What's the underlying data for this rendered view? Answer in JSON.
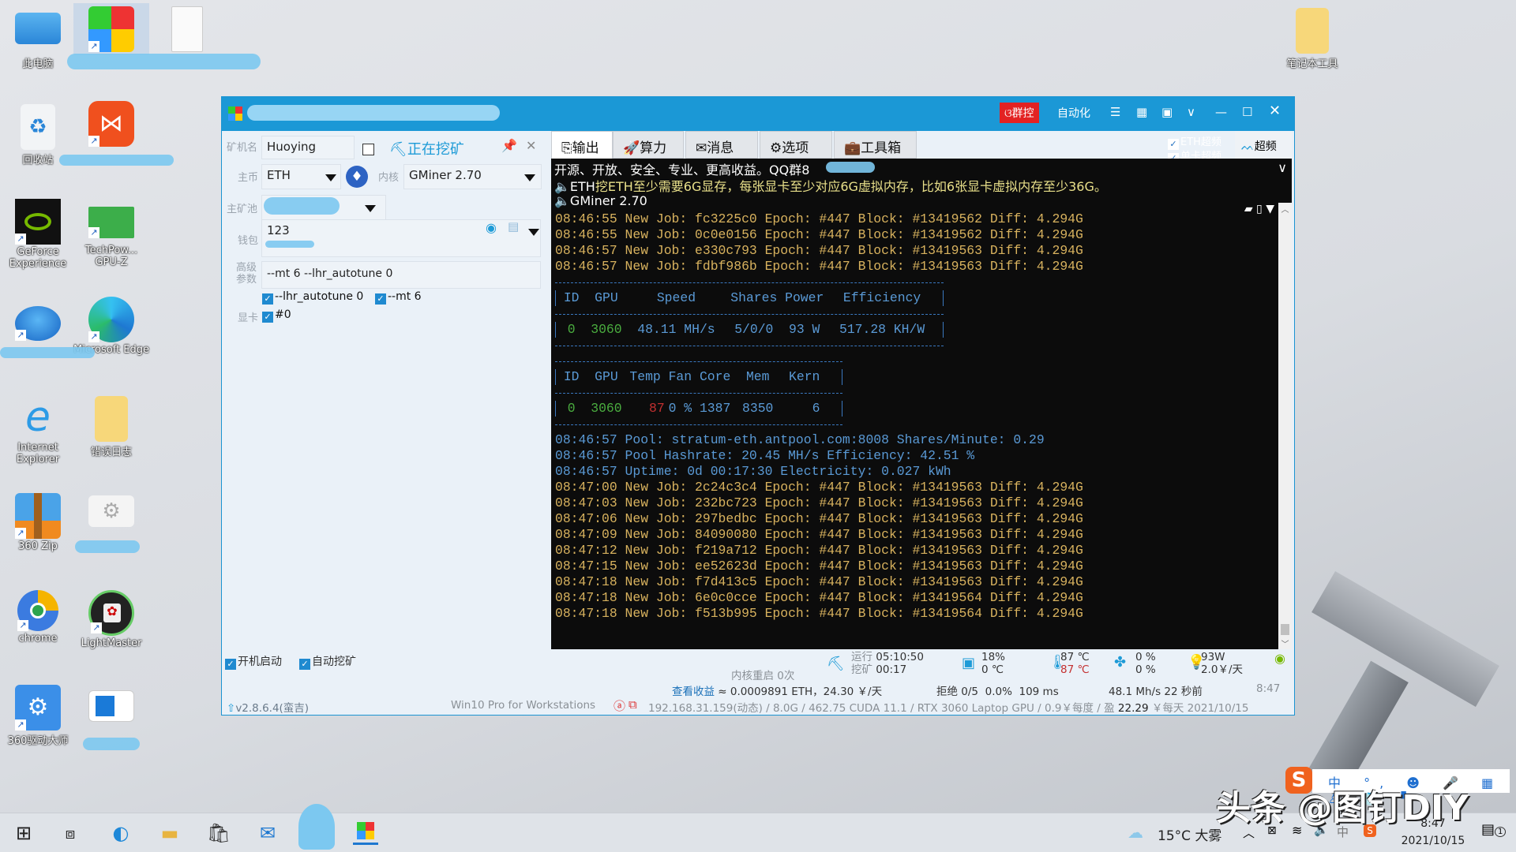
{
  "desktop": {
    "icons": [
      {
        "label": "此电脑"
      },
      {
        "label": "回收站"
      },
      {
        "label": "GeForce Experience"
      },
      {
        "label": "Internet Explorer"
      },
      {
        "label": "360 Zip"
      },
      {
        "label": "chrome"
      },
      {
        "label": "360驱动大师"
      },
      {
        "label": "TechPow... GPU-Z"
      },
      {
        "label": "Microsoft Edge"
      },
      {
        "label": "错误日志"
      },
      {
        "label": "LightMaster"
      },
      {
        "label": "笔记本工具"
      }
    ]
  },
  "window": {
    "title_buttons": {
      "group": "群控",
      "auto": "自动化"
    },
    "left": {
      "miner_name_label": "矿机名",
      "miner_name": "Huoying",
      "status": "正在挖矿",
      "coin_label": "主币",
      "coin": "ETH",
      "kernel_label": "内核",
      "kernel": "GMiner 2.70",
      "pool_label": "主矿池",
      "wallet_label": "钱包",
      "wallet": "123",
      "params_label_1": "高级",
      "params_label_2": "参数",
      "params": "--mt 6 --lhr_autotune 0",
      "opt1": "--lhr_autotune 0",
      "opt2": "--mt 6",
      "gpu_label": "显卡",
      "gpu": "#0",
      "autostart": "开机启动",
      "automine": "自动挖矿"
    },
    "tabs": [
      "输出",
      "算力",
      "消息",
      "选项",
      "工具箱"
    ],
    "oc": {
      "eth_oc": "ETH超频",
      "card_oc": "单卡超频",
      "oc_button": "超频"
    },
    "announcements": [
      "开源、开放、安全、专业、更高收益。QQ群8",
      "挖ETH至少需要6G显存，每张显卡至少对应6G虚拟内存，比如6张显卡虚拟内存至少36G。",
      "GMiner 2.70"
    ],
    "ann_prefix": "ETH",
    "log_top": [
      "08:46:55 New Job: fc3225c0 Epoch: #447 Block: #13419562 Diff: 4.294G",
      "08:46:55 New Job: 0c0e0156 Epoch: #447 Block: #13419562 Diff: 4.294G",
      "08:46:57 New Job: e330c793 Epoch: #447 Block: #13419563 Diff: 4.294G",
      "08:46:57 New Job: fdbf986b Epoch: #447 Block: #13419563 Diff: 4.294G"
    ],
    "table1": {
      "headers": [
        "ID",
        "GPU",
        "Speed",
        "Shares",
        "Power",
        "Efficiency"
      ],
      "row": [
        "0",
        "3060",
        "48.11 MH/s",
        "5/0/0",
        "93 W",
        "517.28 KH/W"
      ]
    },
    "table2": {
      "headers": [
        "ID",
        "GPU",
        "Temp",
        "Fan",
        "Core",
        "Mem",
        "Kern"
      ],
      "row": [
        "0",
        "3060",
        "87",
        "0 %",
        "1387",
        "8350",
        "6"
      ]
    },
    "log_info": [
      "08:46:57 Pool: stratum-eth.antpool.com:8008 Shares/Minute: 0.29",
      "08:46:57 Pool Hashrate: 20.45 MH/s Efficiency: 42.51 %",
      "08:46:57 Uptime: 0d 00:17:30 Electricity: 0.027 kWh"
    ],
    "log_bottom": [
      "08:47:00 New Job: 2c24c3c4 Epoch: #447 Block: #13419563 Diff: 4.294G",
      "08:47:03 New Job: 232bc723 Epoch: #447 Block: #13419563 Diff: 4.294G",
      "08:47:06 New Job: 297bedbc Epoch: #447 Block: #13419563 Diff: 4.294G",
      "08:47:09 New Job: 84090080 Epoch: #447 Block: #13419563 Diff: 4.294G",
      "08:47:12 New Job: f219a712 Epoch: #447 Block: #13419563 Diff: 4.294G",
      "08:47:15 New Job: ee52623d Epoch: #447 Block: #13419563 Diff: 4.294G",
      "08:47:18 New Job: f7d413c5 Epoch: #447 Block: #13419563 Diff: 4.294G",
      "08:47:18 New Job: 6e0c0cce Epoch: #447 Block: #13419564 Diff: 4.294G",
      "08:47:18 New Job: f513b995 Epoch: #447 Block: #13419564 Diff: 4.294G"
    ],
    "status": {
      "run_label": "运行",
      "run_time": "05:10:50",
      "mine_label": "挖矿",
      "mine_time": "00:17",
      "cpu_usage": "18%",
      "cpu_temp": "0 ℃",
      "gpu_temp1": "87 ℃",
      "gpu_temp2": "87 ℃",
      "fan1": "0 %",
      "fan2": "0 %",
      "power": "93W",
      "power_cost": "2.0￥/天",
      "restart": "内核重启 0次",
      "earnings_link": "查看收益",
      "earnings": "≈ 0.0009891 ETH，24.30 ￥/天",
      "reject": "拒绝 0/5  0.0%  109 ms",
      "hashrate": "48.1 Mh/s 22 秒前",
      "time": "8:47",
      "version": "v2.8.6.4(蛮吉)",
      "os": "Win10 Pro for Workstations",
      "sysinfo": "192.168.31.159(动态) / 8.0G / 462.75 CUDA 11.1 / RTX 3060 Laptop GPU / 0.9￥每度 / 盈",
      "profit": "22.29",
      "profit_unit": "￥每天",
      "date": "2021/10/15"
    }
  },
  "taskbar": {
    "weather": "15°C 大雾",
    "ime": "中",
    "clock_time": "8:47",
    "clock_date": "2021/10/15",
    "notifications": "1"
  },
  "watermark": "头条 @图钉DIY",
  "colors": {
    "accent": "#1b98d6",
    "job": "#d8b25e",
    "info": "#5a9ad6",
    "green": "#4aad3f",
    "red": "#c43030"
  }
}
